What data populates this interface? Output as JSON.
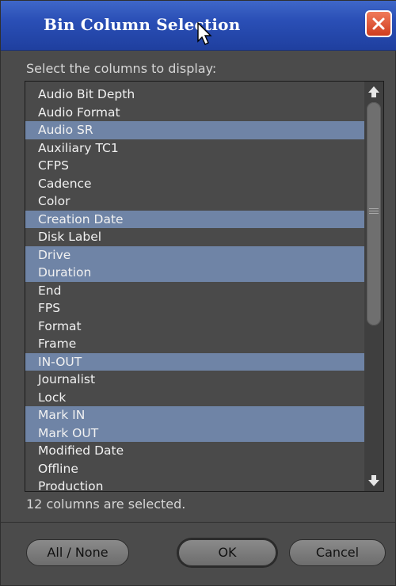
{
  "window": {
    "title": "Bin Column Selection"
  },
  "prompt": "Select the columns to display:",
  "columns": [
    {
      "label": "Audio Bit Depth",
      "selected": false
    },
    {
      "label": "Audio Format",
      "selected": false
    },
    {
      "label": "Audio SR",
      "selected": true
    },
    {
      "label": "Auxiliary TC1",
      "selected": false
    },
    {
      "label": "CFPS",
      "selected": false
    },
    {
      "label": "Cadence",
      "selected": false
    },
    {
      "label": "Color",
      "selected": false
    },
    {
      "label": "Creation Date",
      "selected": true
    },
    {
      "label": "Disk Label",
      "selected": false
    },
    {
      "label": "Drive",
      "selected": true
    },
    {
      "label": "Duration",
      "selected": true
    },
    {
      "label": "End",
      "selected": false
    },
    {
      "label": "FPS",
      "selected": false
    },
    {
      "label": "Format",
      "selected": false
    },
    {
      "label": "Frame",
      "selected": false
    },
    {
      "label": "IN-OUT",
      "selected": true
    },
    {
      "label": "Journalist",
      "selected": false
    },
    {
      "label": "Lock",
      "selected": false
    },
    {
      "label": "Mark IN",
      "selected": true
    },
    {
      "label": "Mark OUT",
      "selected": true
    },
    {
      "label": "Modified Date",
      "selected": false
    },
    {
      "label": "Offline",
      "selected": false
    },
    {
      "label": "Production",
      "selected": false
    }
  ],
  "status": "12 columns are selected.",
  "buttons": {
    "all_none": "All / None",
    "ok": "OK",
    "cancel": "Cancel"
  },
  "icons": {
    "close": "close-icon",
    "cursor": "mouse-pointer-icon",
    "scroll_up": "arrow-up-icon",
    "scroll_down": "arrow-down-icon"
  },
  "colors": {
    "title_bar": "#2a4fb6",
    "selection": "#6f84a6",
    "close_button": "#cf3d1f"
  }
}
